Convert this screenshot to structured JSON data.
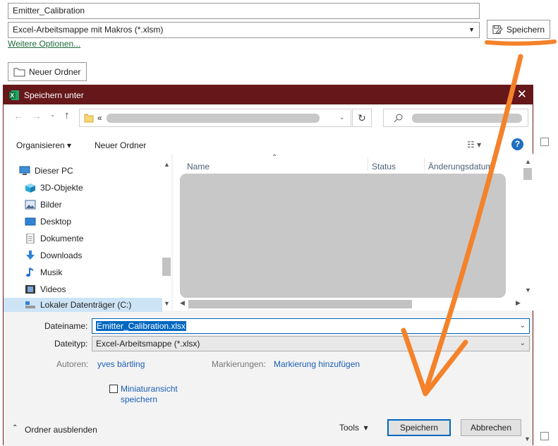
{
  "backstage": {
    "filename_value": "Emitter_Calibration",
    "filetype_value": "Excel-Arbeitsmappe mit Makros (*.xlsm)",
    "more_options_link": "Weitere Optionen...",
    "save_button": "Speichern",
    "new_folder_button": "Neuer Ordner"
  },
  "dialog": {
    "title": "Speichern unter",
    "address_prefix": "«",
    "toolbar": {
      "organize": "Organisieren",
      "new_folder": "Neuer Ordner"
    },
    "nav_items": [
      {
        "label": "Dieser PC",
        "icon": "pc-icon"
      },
      {
        "label": "3D-Objekte",
        "icon": "3d-objects-icon"
      },
      {
        "label": "Bilder",
        "icon": "pictures-icon"
      },
      {
        "label": "Desktop",
        "icon": "desktop-icon"
      },
      {
        "label": "Dokumente",
        "icon": "documents-icon"
      },
      {
        "label": "Downloads",
        "icon": "downloads-icon"
      },
      {
        "label": "Musik",
        "icon": "music-icon"
      },
      {
        "label": "Videos",
        "icon": "videos-icon"
      },
      {
        "label": "Lokaler Datenträger (C:)",
        "icon": "drive-icon"
      }
    ],
    "columns": {
      "name": "Name",
      "status": "Status",
      "modified": "Änderungsdatum"
    },
    "fields": {
      "filename_label": "Dateiname:",
      "filename_value": "Emitter_Calibration.xlsx",
      "filetype_label": "Dateityp:",
      "filetype_value": "Excel-Arbeitsmappe (*.xlsx)",
      "authors_label": "Autoren:",
      "authors_value": "yves bärtling",
      "tags_label": "Markierungen:",
      "tags_value": "Markierung hinzufügen",
      "thumbnail_line1": "Miniaturansicht",
      "thumbnail_line2": "speichern"
    },
    "footer": {
      "hide_folders": "Ordner ausblenden",
      "tools": "Tools",
      "save": "Speichern",
      "cancel": "Abbrechen"
    }
  },
  "colors": {
    "titlebar": "#65171a",
    "accent": "#0067c0",
    "annotation": "#f4822a"
  }
}
